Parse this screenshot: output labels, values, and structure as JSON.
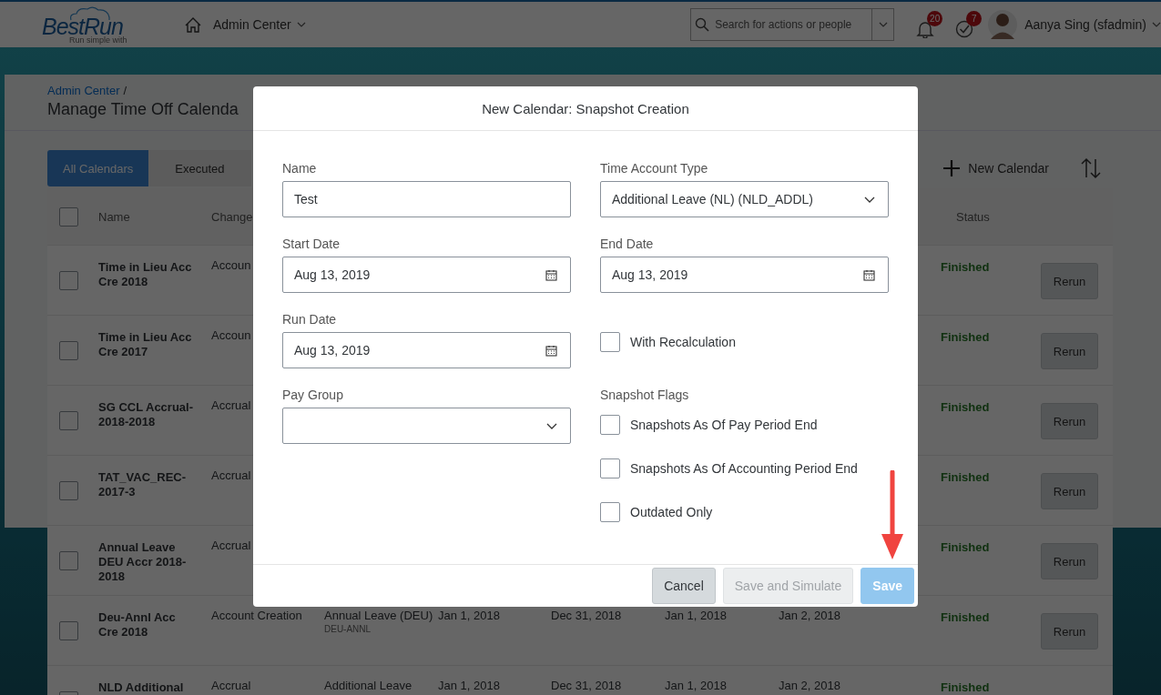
{
  "header": {
    "logo": "BestRun",
    "logo_tagline": "Run simple with",
    "nav": "Admin Center",
    "search": {
      "placeholder": "Search for actions or people"
    },
    "notifications": "20",
    "tasks": "7",
    "user": "Aanya Sing (sfadmin)"
  },
  "page": {
    "breadcrumb": "Admin Center",
    "breadcrumb_separator": "/",
    "title": "Manage Time Off Calenda"
  },
  "tabs": [
    {
      "label": "All Calendars",
      "selected": true
    },
    {
      "label": "Executed",
      "selected": false
    }
  ],
  "toolbar": {
    "new_button": "New Calendar"
  },
  "table": {
    "select_all_checked": false,
    "columns": [
      "Name",
      "Change",
      "Status"
    ],
    "rows": [
      {
        "checked": false,
        "name": "Time in Lieu Acc Cre 2018",
        "change": "Accoun",
        "status": "Finished",
        "action": "Rerun"
      },
      {
        "checked": false,
        "name": "Time in Lieu Acc Cre 2017",
        "change": "Accoun",
        "status": "Finished",
        "action": "Rerun"
      },
      {
        "checked": false,
        "name": "SG CCL Accrual-2018-2018",
        "change": "Accrual",
        "status": "Finished",
        "action": "Rerun"
      },
      {
        "checked": false,
        "name": "TAT_VAC_REC-2017-3",
        "change": "Accrual",
        "status": "Finished",
        "action": "Rerun"
      },
      {
        "checked": false,
        "name": "Annual Leave DEU Accr 2018-2018",
        "change": "Accrual",
        "status": "Finished",
        "action": "Rerun"
      },
      {
        "checked": false,
        "name": "Deu-Annl Acc Cre 2018",
        "change": "Account Creation",
        "column_4": "Annual Leave (DEU)",
        "column_4_code": "DEU-ANNL",
        "column_5": "Jan 1, 2018",
        "column_6": "Dec 31, 2018",
        "column_7": "Jan 1, 2018",
        "column_8": "Jan 2, 2018",
        "status": "Finished",
        "action": "Rerun"
      },
      {
        "checked": false,
        "name": "NLD Additional",
        "change": "Accrual",
        "column_4": "Additional Leave",
        "column_5": "Jan 1, 2018",
        "column_6": "Dec 31, 2018",
        "column_7": "Jan 1, 2018",
        "column_8": "Jan 2, 2018",
        "status": "Finished"
      }
    ]
  },
  "dialog": {
    "title": "New Calendar: Snapshot Creation",
    "left_fields": [
      {
        "kind": "text",
        "label": "Name",
        "value": "Test"
      },
      {
        "kind": "date",
        "label": "Start Date",
        "value": "Aug 13, 2019"
      },
      {
        "kind": "date",
        "label": "Run Date",
        "value": "Aug 13, 2019"
      },
      {
        "kind": "select",
        "label": "Pay Group"
      }
    ],
    "right_fields": [
      {
        "kind": "select",
        "label": "Time Account Type",
        "value": "Additional Leave (NL) (NLD_ADDL)"
      },
      {
        "kind": "date",
        "label": "End Date",
        "value": "Aug 13, 2019"
      },
      {
        "kind": "checkbox",
        "label": "With Recalculation",
        "checked": false
      },
      {
        "kind": "group",
        "label": "Snapshot Flags",
        "options": [
          {
            "label": "Snapshots As Of Pay Period End",
            "checked": false
          },
          {
            "label": "Snapshots As Of Accounting Period End",
            "checked": false
          },
          {
            "label": "Outdated Only",
            "checked": false
          }
        ]
      }
    ],
    "buttons": [
      {
        "label": "Cancel",
        "kind": "secondary",
        "disabled": false
      },
      {
        "label": "Save and Simulate",
        "kind": "secondary",
        "disabled": true
      },
      {
        "label": "Save",
        "kind": "primary",
        "disabled": true
      }
    ]
  }
}
